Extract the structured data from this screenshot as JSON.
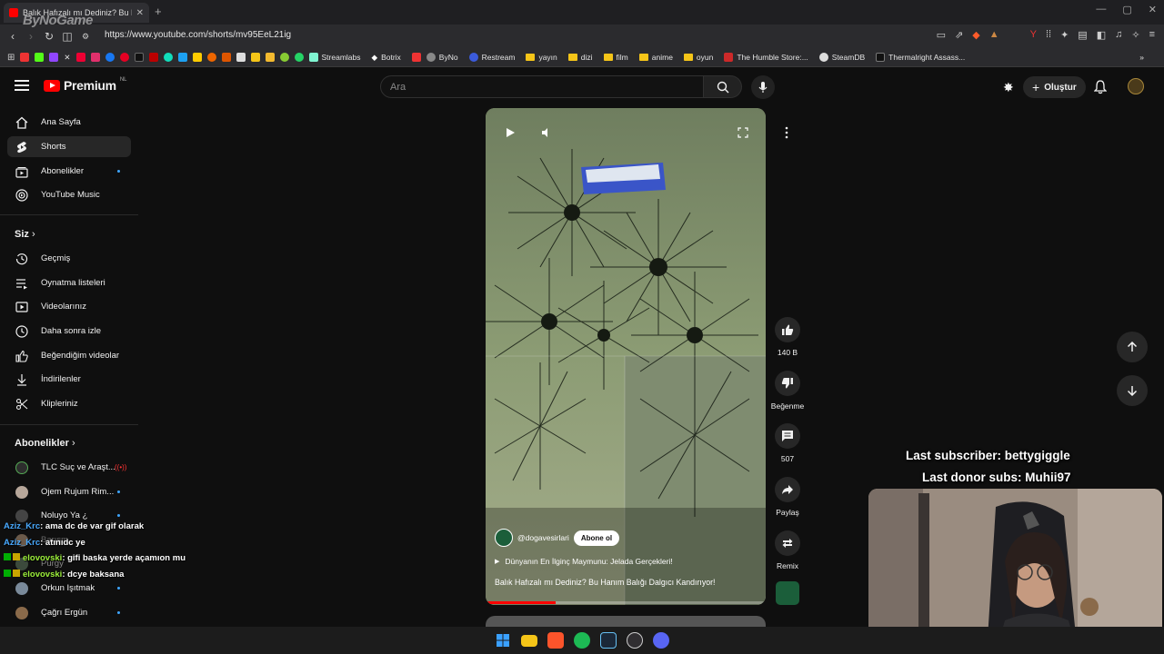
{
  "browser": {
    "tab_title": "Balık Hafızalı mı Dediniz? Bu Han",
    "url": "https://www.youtube.com/shorts/mv95EeL21ig",
    "bookmarks": [
      {
        "label": "Streamlabs"
      },
      {
        "label": "Botrix"
      },
      {
        "label": "ByNo"
      },
      {
        "label": "Restream"
      },
      {
        "label": "yayın"
      },
      {
        "label": "dizi"
      },
      {
        "label": "film"
      },
      {
        "label": "anime"
      },
      {
        "label": "oyun"
      },
      {
        "label": "The Humble Store:..."
      },
      {
        "label": "SteamDB"
      },
      {
        "label": "Thermalright Assass..."
      }
    ]
  },
  "header": {
    "logo_text": "Premium",
    "logo_country": "NL",
    "search_placeholder": "Ara",
    "create_label": "Oluştur"
  },
  "sidebar": {
    "main": [
      {
        "label": "Ana Sayfa",
        "icon": "home-icon"
      },
      {
        "label": "Shorts",
        "icon": "shorts-icon",
        "active": true
      },
      {
        "label": "Abonelikler",
        "icon": "subscriptions-icon",
        "dot": true
      },
      {
        "label": "YouTube Music",
        "icon": "music-icon"
      }
    ],
    "you_heading": "Siz",
    "you": [
      {
        "label": "Geçmiş",
        "icon": "history-icon"
      },
      {
        "label": "Oynatma listeleri",
        "icon": "playlists-icon"
      },
      {
        "label": "Videolarınız",
        "icon": "your-videos-icon"
      },
      {
        "label": "Daha sonra izle",
        "icon": "watch-later-icon"
      },
      {
        "label": "Beğendiğim videolar",
        "icon": "liked-icon"
      },
      {
        "label": "İndirilenler",
        "icon": "downloads-icon"
      },
      {
        "label": "Klipleriniz",
        "icon": "clips-icon"
      }
    ],
    "subs_heading": "Abonelikler",
    "subs": [
      {
        "label": "TLC Suç ve Araşt...",
        "color": "#2d2d2d"
      },
      {
        "label": "Ojem Rujum Rim...",
        "color": "#b7a79a"
      },
      {
        "label": "Noluyo Ya ¿",
        "color": "#444"
      },
      {
        "label": "Barışm",
        "color": "#6b5a4a"
      },
      {
        "label": "Purgy",
        "color": "#3c4a3c"
      },
      {
        "label": "Orkun Işıtmak",
        "color": "#7a8a9a"
      },
      {
        "label": "Çağrı Ergün",
        "color": "#8a6a4a"
      }
    ]
  },
  "short": {
    "channel": "@dogavesirlari",
    "subscribe_label": "Abone ol",
    "related_link": "Dünyanın En İlginç Maymunu: Jelada Gerçekleri!",
    "title": "Balık Hafızalı mı Dediniz? Bu Hanım Balığı Dalgıcı Kandırıyor!",
    "progress": 0.25,
    "actions": {
      "likes": "140 B",
      "dislike_label": "Beğenme",
      "comments": "507",
      "share_label": "Paylaş",
      "remix_label": "Remix"
    }
  },
  "stream_overlay": {
    "brand": "ByNoGame",
    "last_subscriber": "Last subscriber: bettygiggle",
    "last_donor": "Last donor subs: Muhii97",
    "chat": [
      {
        "user": "Aziz_Krc",
        "msg": ": ama dc de var gif olarak",
        "color": "u"
      },
      {
        "user": "Aziz_Krc",
        "msg": ": atınıdc ye",
        "color": "u"
      },
      {
        "user": "elovovski",
        "msg": ": gifi baska yerde açamıon mu",
        "color": "g"
      },
      {
        "user": "elovovski",
        "msg": ": dcye baksana",
        "color": "g"
      }
    ]
  }
}
